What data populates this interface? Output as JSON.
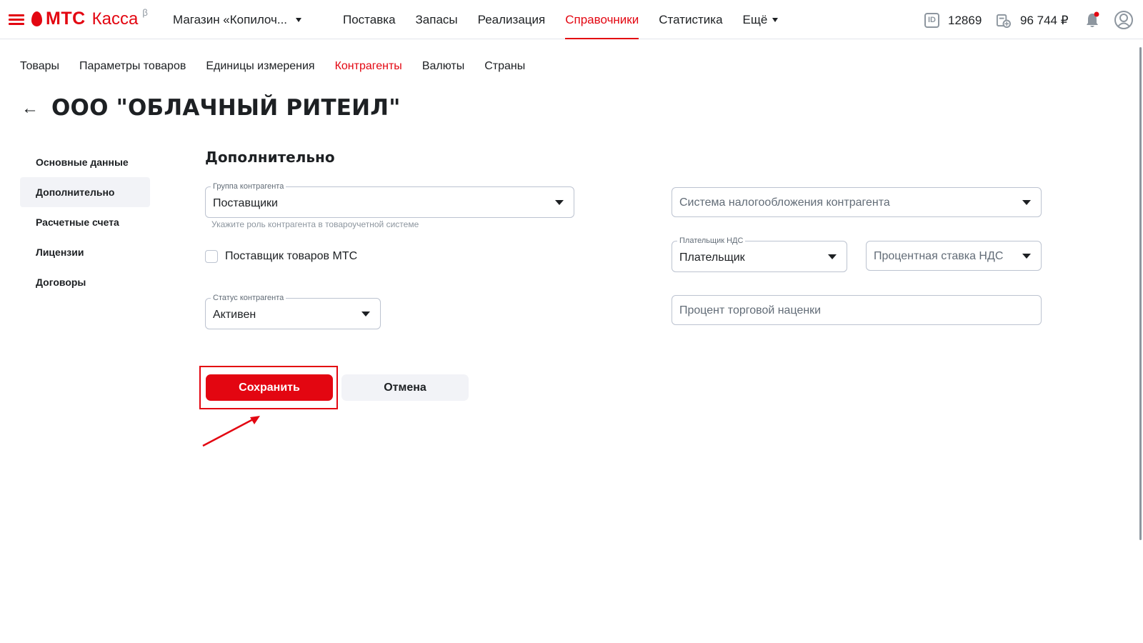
{
  "header": {
    "logo_brand": "МТС",
    "logo_product": "Касса",
    "logo_beta": "β",
    "store_name": "Магазин «Копилоч...",
    "nav": [
      {
        "label": "Поставка"
      },
      {
        "label": "Запасы"
      },
      {
        "label": "Реализация"
      },
      {
        "label": "Справочники",
        "active": true
      },
      {
        "label": "Статистика"
      },
      {
        "label": "Ещё"
      }
    ],
    "id_badge": "ID",
    "account_id": "12869",
    "balance": "96 744 ₽"
  },
  "subnav": [
    {
      "label": "Товары"
    },
    {
      "label": "Параметры товаров"
    },
    {
      "label": "Единицы измерения"
    },
    {
      "label": "Контрагенты",
      "active": true
    },
    {
      "label": "Валюты"
    },
    {
      "label": "Страны"
    }
  ],
  "page": {
    "back": "←",
    "title": "ООО \"ОБЛАЧНЫЙ РИТЕИЛ\""
  },
  "sidemenu": [
    {
      "label": "Основные данные"
    },
    {
      "label": "Дополнительно",
      "active": true
    },
    {
      "label": "Расчетные счета"
    },
    {
      "label": "Лицензии"
    },
    {
      "label": "Договоры"
    }
  ],
  "form": {
    "section_title": "Дополнительно",
    "group": {
      "label": "Группа контрагента",
      "value": "Поставщики",
      "hint": "Укажите роль контрагента в товароучетной системе"
    },
    "mts_supplier": {
      "label": "Поставщик товаров МТС",
      "checked": false
    },
    "status": {
      "label": "Статус контрагента",
      "value": "Активен"
    },
    "tax_system": {
      "placeholder": "Система налогообложения контрагента"
    },
    "vat_payer": {
      "label": "Плательщик НДС",
      "value": "Плательщик"
    },
    "vat_rate": {
      "placeholder": "Процентная ставка НДС"
    },
    "markup": {
      "placeholder": "Процент торговой наценки"
    },
    "save_label": "Сохранить",
    "cancel_label": "Отмена"
  },
  "colors": {
    "accent": "#e30611",
    "annotation": "#e30611"
  }
}
